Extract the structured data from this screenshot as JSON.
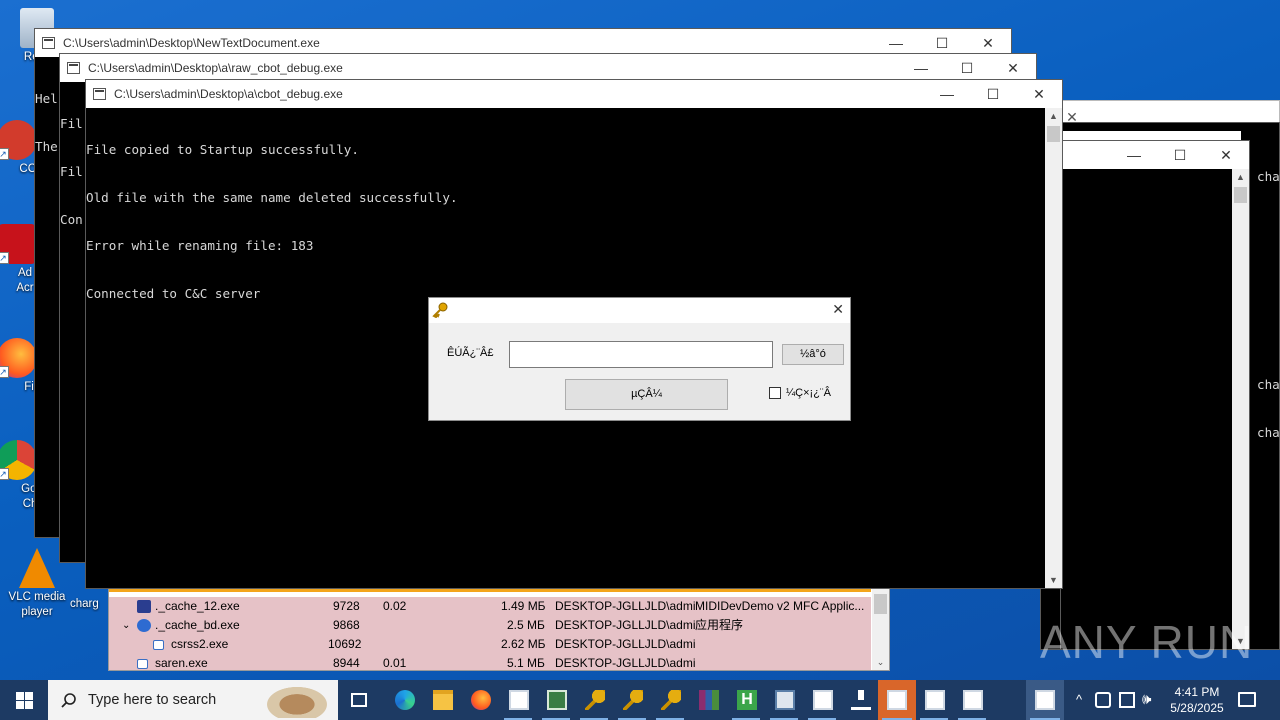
{
  "desktop": {
    "icons": [
      {
        "label": "Recy"
      },
      {
        "label": "CCl"
      },
      {
        "label": "Ad Acr"
      },
      {
        "label": "Fir"
      },
      {
        "label": "Goo Chr"
      },
      {
        "label": "VLC media player"
      },
      {
        "label": "charg"
      }
    ]
  },
  "windows": {
    "w1": {
      "title": "C:\\Users\\admin\\Desktop\\NewTextDocument.exe",
      "lines": [
        "Hel",
        "The"
      ]
    },
    "w2": {
      "title": "C:\\Users\\admin\\Desktop\\a\\raw_cbot_debug.exe",
      "lines": [
        "Fil",
        "Fil",
        "Con"
      ]
    },
    "w3": {
      "title": "C:\\Users\\admin\\Desktop\\a\\cbot_debug.exe",
      "lines": [
        "File copied to Startup successfully.",
        "Old file with the same name deleted successfully.",
        "Error while renaming file: 183",
        "Connected to C&C server"
      ]
    },
    "w5": {
      "lines": [
        "cha",
        "cha",
        "cha"
      ]
    },
    "controls": {
      "minimize": "—",
      "maximize": "☐",
      "close": "✕"
    }
  },
  "task_manager": {
    "rows": [
      {
        "name": "._cache_12.exe",
        "pid": "9728",
        "cpu": "0.02",
        "mem": "1.49 МБ",
        "user": "DESKTOP-JGLLJLD\\admi",
        "desc": "MIDIDevDemo v2 MFC Applic..."
      },
      {
        "name": "._cache_bd.exe",
        "pid": "9868",
        "cpu": "",
        "mem": "2.5 МБ",
        "user": "DESKTOP-JGLLJLD\\admi",
        "desc": "应用程序"
      },
      {
        "name": "csrss2.exe",
        "pid": "10692",
        "cpu": "",
        "mem": "2.62 МБ",
        "user": "DESKTOP-JGLLJLD\\admi",
        "desc": ""
      },
      {
        "name": "saren.exe",
        "pid": "8944",
        "cpu": "0.01",
        "mem": "5.1 МБ",
        "user": "DESKTOP-JGLLJLD\\admi",
        "desc": ""
      }
    ]
  },
  "dialog": {
    "field_label": "ÊÚÃ¿¨Â£",
    "input_value": "",
    "browse_button": "½â°ó",
    "login_button": "µÇÂ¼",
    "checkbox_label": "¼Ç×¡¿¨Â",
    "checkbox_checked": false
  },
  "watermark": "ANY RUN",
  "taskbar": {
    "search_placeholder": "Type here to search",
    "time": "4:41 PM",
    "date": "5/28/2025"
  }
}
